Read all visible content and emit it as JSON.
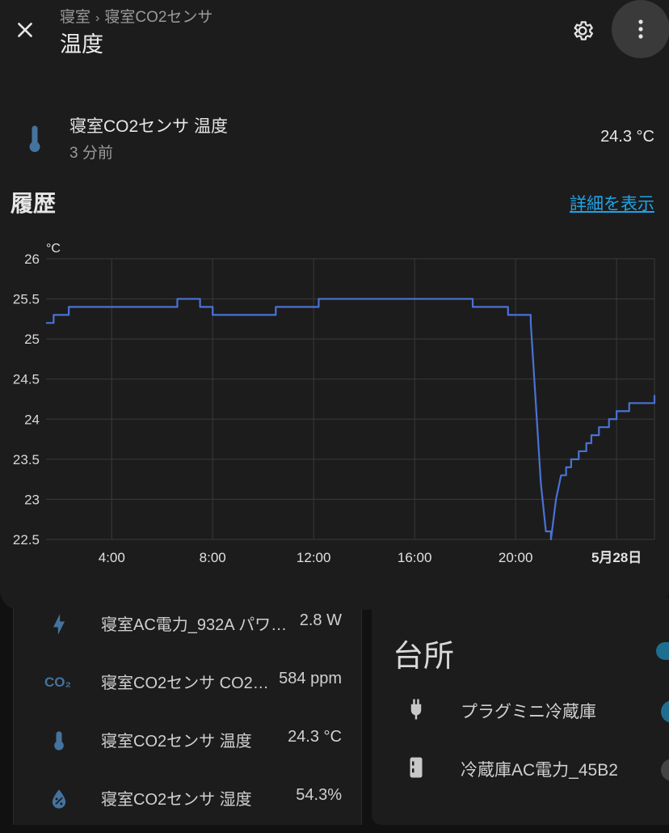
{
  "dialog": {
    "breadcrumb": [
      "寝室",
      "寝室CO2センサ"
    ],
    "breadcrumb_sep": "›",
    "title": "温度",
    "icons": {
      "close": "close-icon",
      "settings": "gear-icon",
      "more": "more-vertical-icon"
    }
  },
  "entity": {
    "name": "寝室CO2センサ 温度",
    "last_changed": "3 分前",
    "state": "24.3 °C",
    "icon": "thermometer-icon"
  },
  "history": {
    "title": "履歴",
    "details_link": "詳細を表示"
  },
  "chart_data": {
    "type": "line",
    "ylabel": "°C",
    "ylim": [
      22.5,
      26
    ],
    "y_ticks": [
      "26",
      "25.5",
      "25",
      "24.5",
      "24",
      "23.5",
      "23",
      "22.5"
    ],
    "x_ticks": [
      "4:00",
      "8:00",
      "12:00",
      "16:00",
      "20:00",
      "5月28日"
    ],
    "xlim_hours": [
      1.4,
      25.5
    ],
    "grid": true,
    "color": "#4a72d6",
    "series": [
      {
        "x": [
          1.4,
          1.7,
          2.0,
          2.3,
          2.8,
          3.2,
          4.5,
          5.0,
          6.0,
          6.6,
          7.0,
          7.5,
          8.0,
          9.0,
          9.8,
          10.5,
          11.5,
          12.2,
          13.0,
          14.0,
          15.0,
          15.6,
          16.2,
          16.8,
          17.5,
          18.3,
          19.0,
          19.7,
          20.3,
          20.6,
          20.8,
          21.0,
          21.2,
          21.4,
          21.6,
          21.8,
          22.0,
          22.2,
          22.5,
          22.8,
          23.0,
          23.3,
          23.7,
          24.0,
          24.5,
          25.0,
          25.5
        ],
        "y": [
          25.2,
          25.3,
          25.3,
          25.4,
          25.4,
          25.4,
          25.4,
          25.4,
          25.4,
          25.5,
          25.5,
          25.4,
          25.3,
          25.3,
          25.3,
          25.4,
          25.4,
          25.5,
          25.5,
          25.5,
          25.5,
          25.5,
          25.5,
          25.5,
          25.5,
          25.4,
          25.4,
          25.3,
          25.3,
          25.2,
          24.2,
          23.2,
          22.6,
          22.5,
          23.0,
          23.3,
          23.4,
          23.5,
          23.6,
          23.7,
          23.8,
          23.9,
          24.0,
          24.1,
          24.2,
          24.2,
          24.3
        ]
      }
    ]
  },
  "background": {
    "left_card": [
      {
        "icon": "lightning-icon",
        "name": "寝室AC電力_932A パワ…",
        "value": "2.8 W"
      },
      {
        "icon": "co2-icon",
        "co2_text": "CO₂",
        "name": "寝室CO2センサ CO2…",
        "value": "584 ppm"
      },
      {
        "icon": "thermometer-icon",
        "name": "寝室CO2センサ 温度",
        "value": "24.3 °C"
      },
      {
        "icon": "water-percent-icon",
        "name": "寝室CO2センサ 湿度",
        "value": "54.3%"
      }
    ],
    "right_card": {
      "title": "台所",
      "items": [
        {
          "icon": "power-plug-icon",
          "name": "プラグミニ冷蔵庫",
          "toggle_color": "#1f6d8f"
        },
        {
          "icon": "fridge-icon",
          "name": "冷蔵庫AC電力_45B2",
          "toggle_color": "#444444"
        }
      ]
    }
  }
}
